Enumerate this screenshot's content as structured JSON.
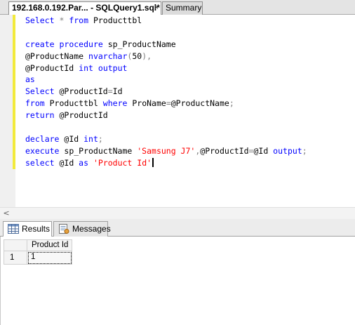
{
  "document_tabs": [
    {
      "label": "192.168.0.192.Par... - SQLQuery1.sql*",
      "active": true,
      "close_glyph": "×"
    },
    {
      "label": "Summary",
      "active": false
    }
  ],
  "code_lines": [
    [
      {
        "t": "Select",
        "c": "kw"
      },
      {
        "t": " * ",
        "c": "gr"
      },
      {
        "t": "from",
        "c": "kw"
      },
      {
        "t": " Producttbl",
        "c": "id"
      }
    ],
    [],
    [
      {
        "t": "create",
        "c": "kw"
      },
      {
        "t": " ",
        "c": "id"
      },
      {
        "t": "procedure",
        "c": "kw"
      },
      {
        "t": " sp_ProductName",
        "c": "id"
      }
    ],
    [
      {
        "t": "@ProductName ",
        "c": "id"
      },
      {
        "t": "nvarchar",
        "c": "kw"
      },
      {
        "t": "(",
        "c": "gr"
      },
      {
        "t": "50",
        "c": "id"
      },
      {
        "t": "),",
        "c": "gr"
      }
    ],
    [
      {
        "t": "@ProductId ",
        "c": "id"
      },
      {
        "t": "int",
        "c": "kw"
      },
      {
        "t": " ",
        "c": "id"
      },
      {
        "t": "output",
        "c": "kw"
      }
    ],
    [
      {
        "t": "as",
        "c": "kw"
      }
    ],
    [
      {
        "t": "Select",
        "c": "kw"
      },
      {
        "t": " @ProductId",
        "c": "id"
      },
      {
        "t": "=",
        "c": "gr"
      },
      {
        "t": "Id",
        "c": "id"
      }
    ],
    [
      {
        "t": "from",
        "c": "kw"
      },
      {
        "t": " Producttbl ",
        "c": "id"
      },
      {
        "t": "where",
        "c": "kw"
      },
      {
        "t": " ProName",
        "c": "id"
      },
      {
        "t": "=",
        "c": "gr"
      },
      {
        "t": "@ProductName",
        "c": "id"
      },
      {
        "t": ";",
        "c": "gr"
      }
    ],
    [
      {
        "t": "return",
        "c": "kw"
      },
      {
        "t": " @ProductId",
        "c": "id"
      }
    ],
    [],
    [
      {
        "t": "declare",
        "c": "kw"
      },
      {
        "t": " @Id ",
        "c": "id"
      },
      {
        "t": "int",
        "c": "kw"
      },
      {
        "t": ";",
        "c": "gr"
      }
    ],
    [
      {
        "t": "execute",
        "c": "kw"
      },
      {
        "t": " sp_ProductName ",
        "c": "id"
      },
      {
        "t": "'Samsung J7'",
        "c": "str"
      },
      {
        "t": ",",
        "c": "gr"
      },
      {
        "t": "@ProductId",
        "c": "id"
      },
      {
        "t": "=",
        "c": "gr"
      },
      {
        "t": "@Id ",
        "c": "id"
      },
      {
        "t": "output",
        "c": "kw"
      },
      {
        "t": ";",
        "c": "gr"
      }
    ],
    [
      {
        "t": "select",
        "c": "kw"
      },
      {
        "t": " @Id ",
        "c": "id"
      },
      {
        "t": "as",
        "c": "kw"
      },
      {
        "t": " ",
        "c": "id"
      },
      {
        "t": "'Product Id'",
        "c": "str"
      }
    ]
  ],
  "scrollbar": {
    "left_arrow": "<"
  },
  "results_tabs": {
    "results_label": "Results",
    "messages_label": "Messages"
  },
  "grid": {
    "columns": [
      "Product Id"
    ],
    "rows": [
      {
        "row_number": "1",
        "cells": [
          "1"
        ]
      }
    ]
  },
  "colors": {
    "keyword": "#0000ff",
    "string": "#ff0000",
    "operator": "#808080",
    "change_bar": "#f2ea3c"
  },
  "icons": {
    "results_tab_icon": "grid-table-icon",
    "messages_tab_icon": "messages-icon"
  }
}
